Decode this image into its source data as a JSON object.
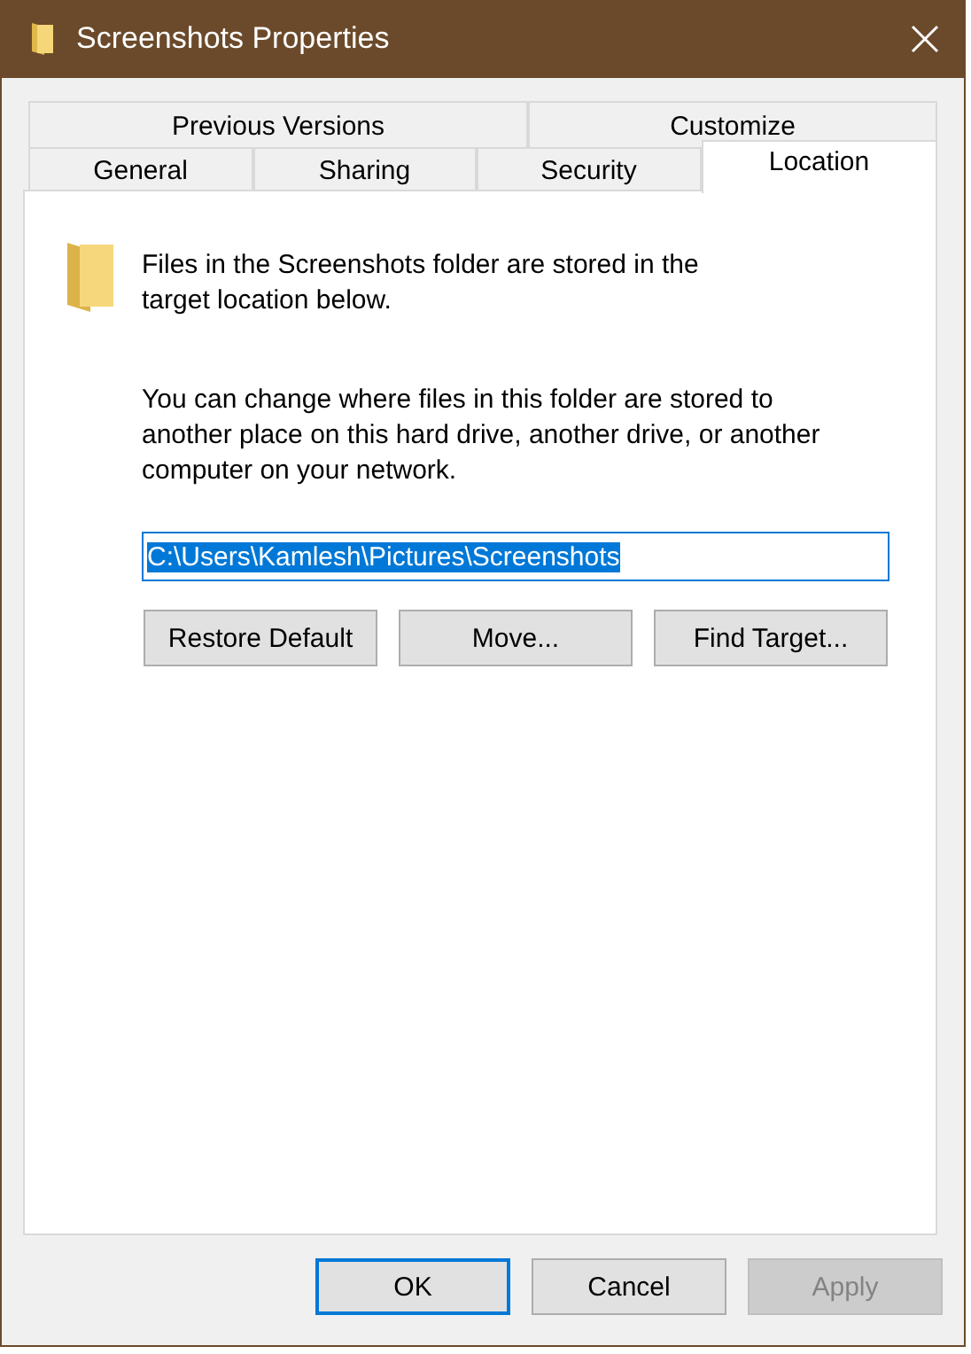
{
  "window": {
    "title": "Screenshots Properties"
  },
  "tab_rows": [
    [
      {
        "label": "Previous Versions",
        "selected": false
      },
      {
        "label": "Customize",
        "selected": false
      }
    ],
    [
      {
        "label": "General",
        "selected": false
      },
      {
        "label": "Sharing",
        "selected": false
      },
      {
        "label": "Security",
        "selected": false
      },
      {
        "label": "Location",
        "selected": true
      }
    ]
  ],
  "description": "Files in the Screenshots folder are stored in the target location below.",
  "explanation": "You can change where files in this folder are stored to another place on this hard drive, another drive, or another computer on your network.",
  "path_field": {
    "value": "C:\\Users\\Kamlesh\\Pictures\\Screenshots",
    "selected": true
  },
  "location_buttons": [
    {
      "label": "Restore Default",
      "disabled": false
    },
    {
      "label": "Move...",
      "disabled": false
    },
    {
      "label": "Find Target...",
      "disabled": false
    }
  ],
  "dialog_buttons": [
    {
      "label": "OK",
      "default": true,
      "disabled": false
    },
    {
      "label": "Cancel",
      "default": false,
      "disabled": false
    },
    {
      "label": "Apply",
      "default": false,
      "disabled": true
    }
  ]
}
